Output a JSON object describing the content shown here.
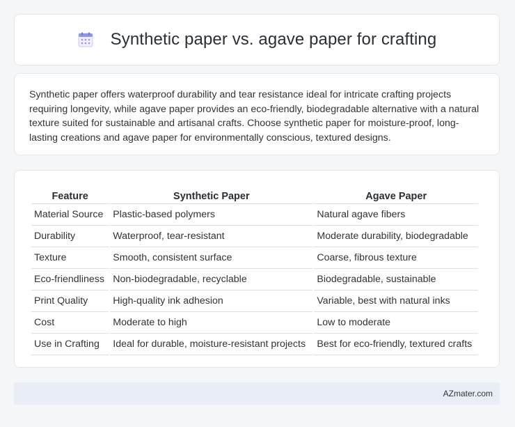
{
  "header": {
    "icon": "calendar-icon",
    "title": "Synthetic paper vs. agave paper for crafting"
  },
  "summary": {
    "text": "Synthetic paper offers waterproof durability and tear resistance ideal for intricate crafting projects requiring longevity, while agave paper provides an eco-friendly, biodegradable alternative with a natural texture suited for sustainable and artisanal crafts. Choose synthetic paper for moisture-proof, long-lasting creations and agave paper for environmentally conscious, textured designs."
  },
  "table": {
    "headers": [
      "Feature",
      "Synthetic Paper",
      "Agave Paper"
    ],
    "rows": [
      [
        "Material Source",
        "Plastic-based polymers",
        "Natural agave fibers"
      ],
      [
        "Durability",
        "Waterproof, tear-resistant",
        "Moderate durability, biodegradable"
      ],
      [
        "Texture",
        "Smooth, consistent surface",
        "Coarse, fibrous texture"
      ],
      [
        "Eco-friendliness",
        "Non-biodegradable, recyclable",
        "Biodegradable, sustainable"
      ],
      [
        "Print Quality",
        "High-quality ink adhesion",
        "Variable, best with natural inks"
      ],
      [
        "Cost",
        "Moderate to high",
        "Low to moderate"
      ],
      [
        "Use in Crafting",
        "Ideal for durable, moisture-resistant projects",
        "Best for eco-friendly, textured crafts"
      ]
    ]
  },
  "footer": {
    "brand": "AZmater.com"
  }
}
